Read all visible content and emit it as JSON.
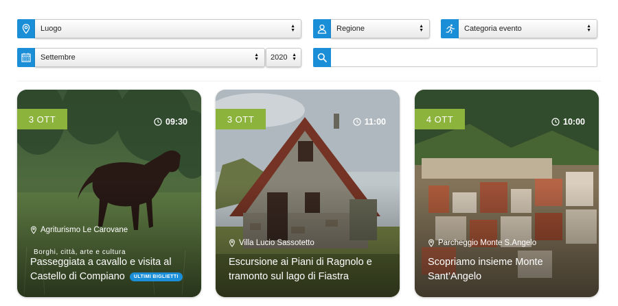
{
  "filters": {
    "luogo": {
      "value": "Luogo",
      "icon": "map-pin-icon"
    },
    "regione": {
      "value": "Regione",
      "icon": "user-icon"
    },
    "categoria": {
      "value": "Categoria evento",
      "icon": "running-person-icon"
    },
    "mese": {
      "value": "Settembre",
      "icon": "calendar-icon"
    },
    "anno": {
      "value": "2020"
    },
    "search": {
      "placeholder": "",
      "icon": "search-icon"
    }
  },
  "colors": {
    "accent": "#1a8fd8",
    "badge": "#8cb43c"
  },
  "events": [
    {
      "date": "3 OTT",
      "time": "09:30",
      "location": "Agriturismo Le Carovane",
      "category": "Borghi, città, arte e cultura",
      "title": "Passeggiata a cavallo e visita al Castello di Compiano",
      "tag": "ULTIMI BIGLIETTI",
      "image": "horse-in-meadow-photo"
    },
    {
      "date": "3 OTT",
      "time": "11:00",
      "location": "Villa Lucio Sassotetto",
      "title": "Escursione ai Piani di Ragnolo e tramonto sul lago di Fiastra",
      "image": "stone-chalet-photo"
    },
    {
      "date": "4 OTT",
      "time": "10:00",
      "location": "Parcheggio Monte S.Angelo",
      "title": "Scopriamo insieme Monte Sant’Angelo",
      "image": "hill-town-photo"
    }
  ]
}
